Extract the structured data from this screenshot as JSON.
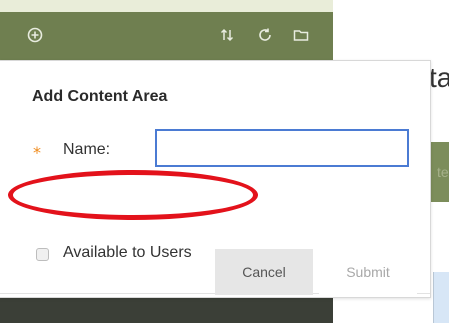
{
  "toolbar": {
    "icons": [
      "add-circle-icon",
      "sort-arrows-icon",
      "refresh-icon",
      "folder-icon"
    ]
  },
  "dialog": {
    "title": "Add Content Area",
    "required_marker": "*",
    "name_label": "Name:",
    "name_value": "",
    "available_label": "Available to Users",
    "available_checked": false,
    "cancel_label": "Cancel",
    "submit_label": "Submit"
  },
  "background": {
    "cut_text": "ta",
    "green_cut_text": "te"
  },
  "colors": {
    "toolbar_green": "#6f7f50",
    "input_focus_blue": "#4b7bd3",
    "required_orange": "#f08a1a",
    "annotation_red": "#e3121b"
  }
}
